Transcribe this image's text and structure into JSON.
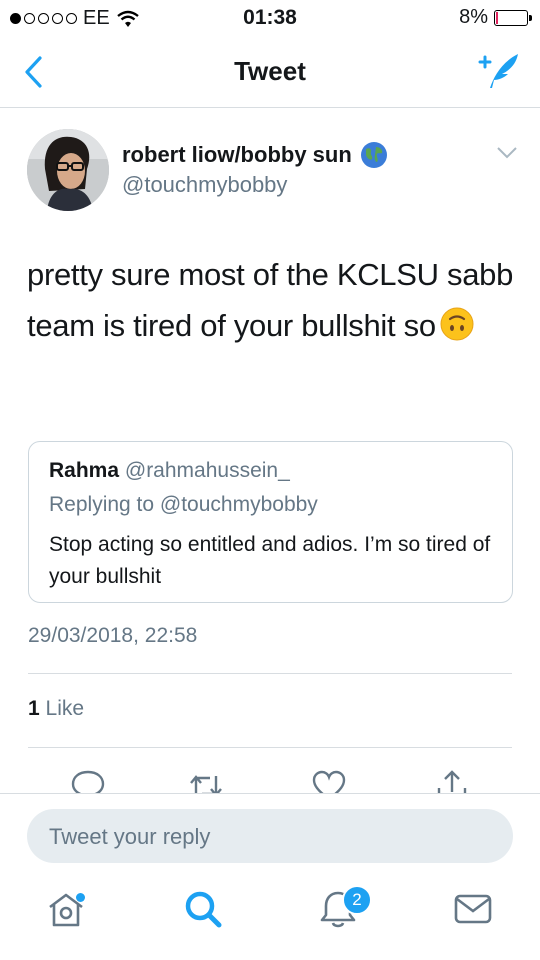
{
  "status_bar": {
    "carrier": "EE",
    "time": "01:38",
    "battery_percent_label": "8%",
    "battery_level": 0.08
  },
  "nav": {
    "title": "Tweet",
    "back_icon": "chevron-left-icon",
    "compose_icon": "compose-tweet-icon"
  },
  "tweet": {
    "author_name": "robert liow/bobby sun",
    "author_emoji": "globe-emoji",
    "author_handle": "@touchmybobby",
    "text": "pretty sure most of the KCLSU sabb team is tired of your bullshit so",
    "text_emoji": "upside-down-face-emoji",
    "quote": {
      "name": "Rahma",
      "handle": "@rahmahussein_",
      "replying_to": "Replying to @touchmybobby",
      "text": "Stop acting so entitled and adios. I’m so tired of your bullshit"
    },
    "timestamp": "29/03/2018, 22:58",
    "likes_count": "1",
    "likes_label": "Like"
  },
  "actions": [
    "reply-icon",
    "retweet-icon",
    "like-icon",
    "share-icon"
  ],
  "reply": {
    "placeholder": "Tweet your reply"
  },
  "tab_bar": {
    "tabs": [
      "home-icon",
      "search-icon",
      "notifications-icon",
      "messages-icon"
    ],
    "notifications_badge": "2"
  },
  "colors": {
    "accent": "#1da1f2",
    "secondary_text": "#657786",
    "battery_low": "#e0245e"
  }
}
